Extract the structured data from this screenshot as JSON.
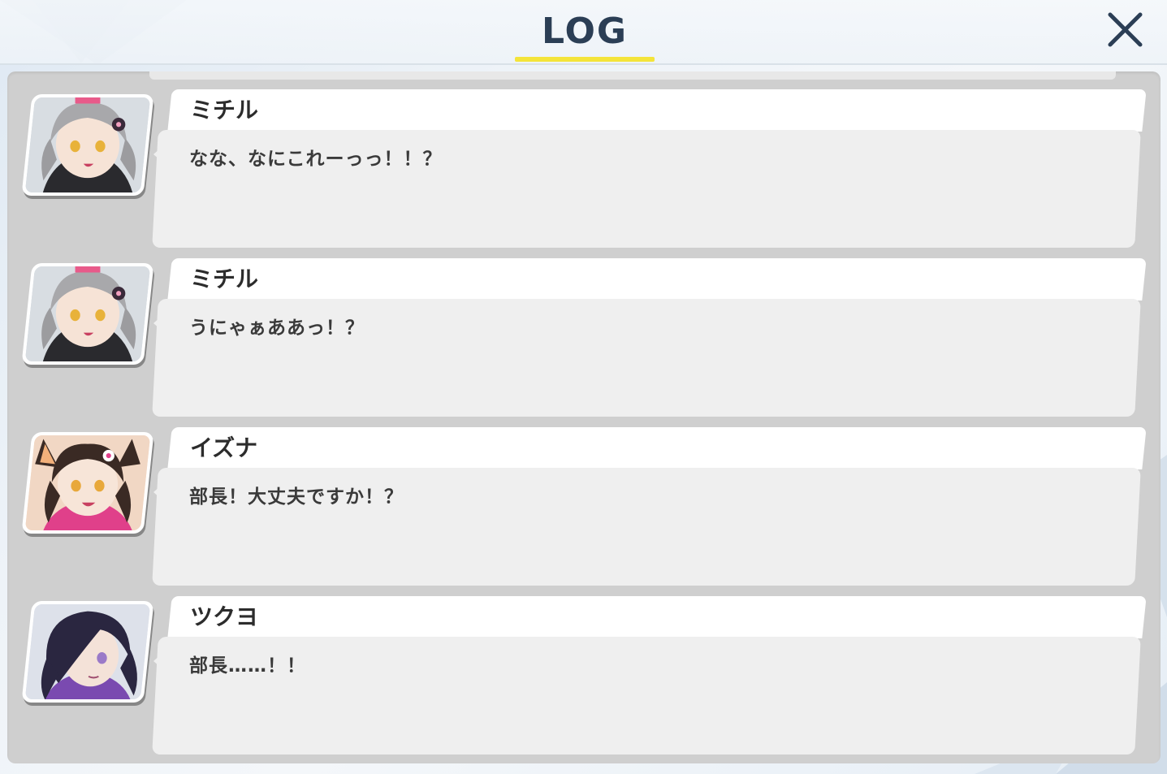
{
  "header": {
    "title": "LOG",
    "close_icon": "close-icon"
  },
  "colors": {
    "title": "#2b3e55",
    "underline": "#f4e43a",
    "panel": "#cfcfcf",
    "message_bg": "#efefef"
  },
  "log": [
    {
      "speaker": "ミチル",
      "text": "なな、なにこれーっっ！！？",
      "avatar": "michiru-portrait"
    },
    {
      "speaker": "ミチル",
      "text": "うにゃぁああっ！？",
      "avatar": "michiru-portrait"
    },
    {
      "speaker": "イズナ",
      "text": "部長！大丈夫ですか！？",
      "avatar": "izuna-portrait"
    },
    {
      "speaker": "ツクヨ",
      "text": "部長……！！",
      "avatar": "tsukuyo-portrait"
    }
  ]
}
